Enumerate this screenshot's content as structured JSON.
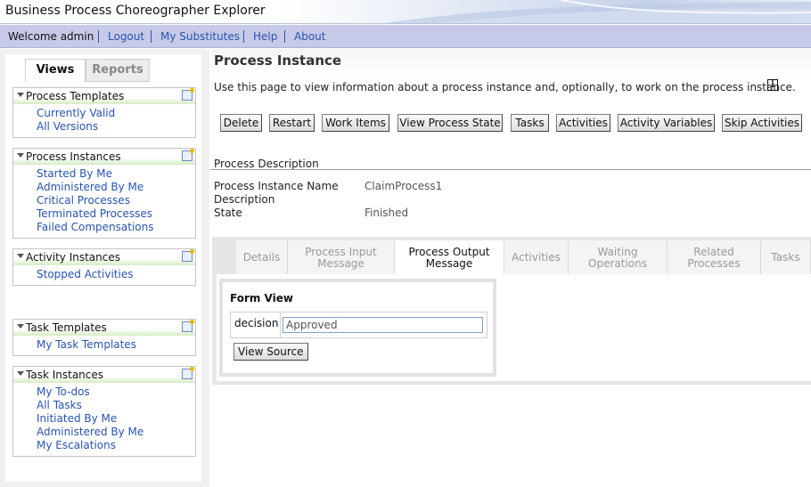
{
  "app": {
    "title": "Business Process Choreographer Explorer"
  },
  "nav": {
    "welcome": "Welcome admin",
    "links": [
      "Logout",
      "My Substitutes",
      "Help",
      "About"
    ]
  },
  "sidebar": {
    "tabs": [
      "Views",
      "Reports"
    ],
    "panels": [
      {
        "title": "Process Templates",
        "items": [
          "Currently Valid",
          "All Versions"
        ]
      },
      {
        "title": "Process Instances",
        "items": [
          "Started By Me",
          "Administered By Me",
          "Critical Processes",
          "Terminated Processes",
          "Failed Compensations"
        ]
      },
      {
        "title": "Activity Instances",
        "items": [
          "Stopped Activities"
        ]
      },
      {
        "title": "Task Templates",
        "items": [
          "My Task Templates"
        ]
      },
      {
        "title": "Task Instances",
        "items": [
          "My To-dos",
          "All Tasks",
          "Initiated By Me",
          "Administered By Me",
          "My Escalations"
        ]
      }
    ]
  },
  "main": {
    "title": "Process Instance",
    "intro": "Use this page to view information about a process instance and, optionally, to work on the process instance.",
    "info_icon": "i",
    "buttons": [
      "Delete",
      "Restart",
      "Work Items",
      "View Process State",
      "Tasks",
      "Activities",
      "Activity Variables",
      "Skip Activities"
    ],
    "description": {
      "section_title": "Process Description",
      "name_label": "Process Instance Name",
      "name_value": "ClaimProcess1",
      "desc_label": "Description",
      "state_label": "State",
      "state_value": "Finished"
    },
    "tabs": [
      {
        "l1": "Details",
        "l2": ""
      },
      {
        "l1": "Process Input",
        "l2": "Message"
      },
      {
        "l1": "Process Output",
        "l2": "Message"
      },
      {
        "l1": "Activities",
        "l2": ""
      },
      {
        "l1": "Waiting",
        "l2": "Operations"
      },
      {
        "l1": "Related",
        "l2": "Processes"
      },
      {
        "l1": "Tasks",
        "l2": ""
      }
    ],
    "form": {
      "title": "Form View",
      "field_label": "decision",
      "field_value": "Approved",
      "view_source": "View Source"
    }
  }
}
